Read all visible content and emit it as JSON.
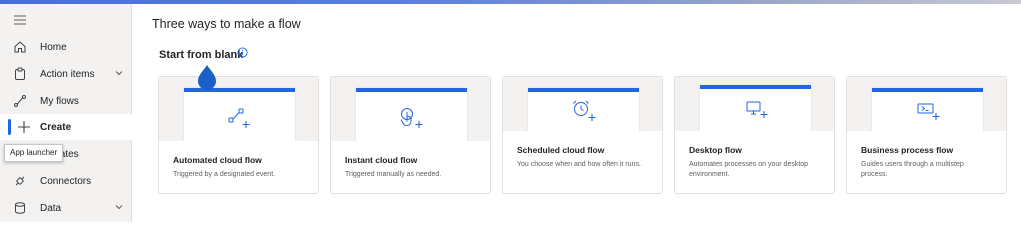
{
  "sidebar": {
    "items": [
      {
        "label": "Home",
        "icon": "home-icon"
      },
      {
        "label": "Action items",
        "icon": "clipboard-icon",
        "expandable": true
      },
      {
        "label": "My flows",
        "icon": "flow-icon"
      },
      {
        "label": "Create",
        "icon": "plus-icon",
        "active": true
      },
      {
        "label": "plates",
        "icon": "templates-icon"
      },
      {
        "label": "Connectors",
        "icon": "connector-icon"
      },
      {
        "label": "Data",
        "icon": "database-icon",
        "expandable": true
      }
    ],
    "tooltip": "App launcher"
  },
  "main": {
    "heading": "Three ways to make a flow",
    "subheading": "Start from blank",
    "cards": [
      {
        "title": "Automated cloud flow",
        "description": "Triggered by a designated event.",
        "icon": "automated-flow-icon"
      },
      {
        "title": "Instant cloud flow",
        "description": "Triggered manually as needed.",
        "icon": "touch-icon"
      },
      {
        "title": "Scheduled cloud flow",
        "description": "You choose when and how often it runs.",
        "icon": "alarm-clock-icon"
      },
      {
        "title": "Desktop flow",
        "description": "Automates processes on your desktop environment.",
        "icon": "desktop-icon"
      },
      {
        "title": "Business process flow",
        "description": "Guides users through a multistep process.",
        "icon": "process-icon"
      }
    ]
  },
  "colors": {
    "accent": "#2266e3",
    "sidebar_bg": "#f3f2f1",
    "thumb_bg": "#f3f2f1"
  }
}
